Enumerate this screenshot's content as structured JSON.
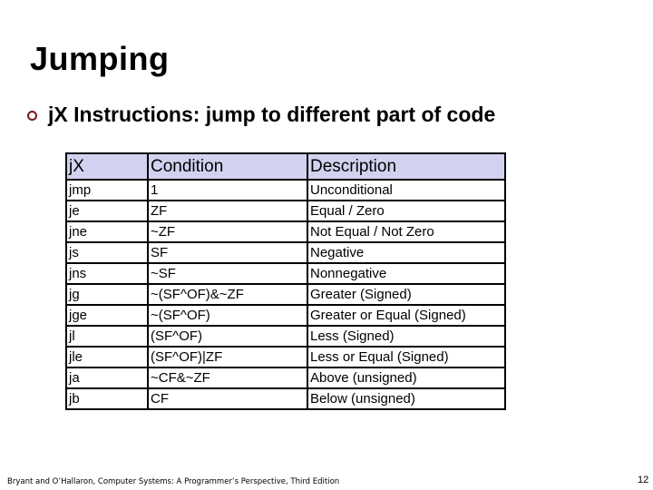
{
  "slide": {
    "title": "Jumping",
    "bullet": {
      "icon": "hollow-circle-bullet",
      "text": "jX Instructions: jump to different part of code"
    },
    "colors": {
      "header_bg": "#d2d2f0",
      "bullet": "#7a1a1a"
    }
  },
  "table": {
    "headers": [
      "jX",
      "Condition",
      "Description"
    ],
    "rows": [
      [
        "jmp",
        "1",
        "Unconditional"
      ],
      [
        "je",
        "ZF",
        "Equal / Zero"
      ],
      [
        "jne",
        "~ZF",
        "Not Equal / Not Zero"
      ],
      [
        "js",
        "SF",
        "Negative"
      ],
      [
        "jns",
        "~SF",
        "Nonnegative"
      ],
      [
        "jg",
        "~(SF^OF)&~ZF",
        "Greater (Signed)"
      ],
      [
        "jge",
        "~(SF^OF)",
        "Greater or Equal (Signed)"
      ],
      [
        "jl",
        "(SF^OF)",
        "Less (Signed)"
      ],
      [
        "jle",
        "(SF^OF)|ZF",
        "Less or Equal (Signed)"
      ],
      [
        "ja",
        "~CF&~ZF",
        "Above (unsigned)"
      ],
      [
        "jb",
        "CF",
        "Below (unsigned)"
      ]
    ]
  },
  "footer": {
    "citation": "Bryant and O’Hallaron, Computer Systems: A Programmer’s Perspective, Third Edition",
    "page_number": "12"
  }
}
